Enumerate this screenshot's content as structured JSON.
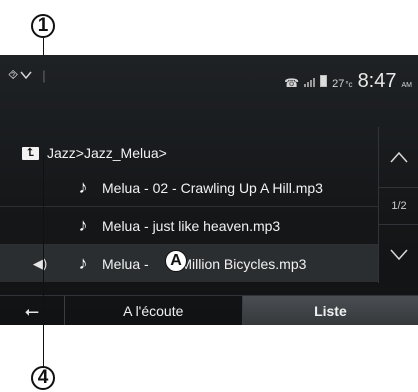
{
  "callouts": {
    "one": "1",
    "four": "4",
    "a": "A"
  },
  "status": {
    "left_icons": [
      "gps-icon",
      "chevron-down-icon"
    ],
    "temp": "27",
    "temp_unit": "°c",
    "time": "8:47",
    "ampm": "AM"
  },
  "browser": {
    "path": "Jazz>Jazz_Melua>",
    "tracks": [
      {
        "name": "Melua - 02 - Crawling Up A Hill.mp3"
      },
      {
        "name": "Melua - just like heaven.mp3"
      },
      {
        "name": "Melua - Nine Million Bicycles.mp3",
        "visible_left": "Melua -",
        "visible_right": "e Million Bicycles.mp3",
        "playing": true
      }
    ],
    "page": "1/2"
  },
  "tabs": {
    "now_playing": "A l'écoute",
    "list": "Liste",
    "active": "list"
  }
}
